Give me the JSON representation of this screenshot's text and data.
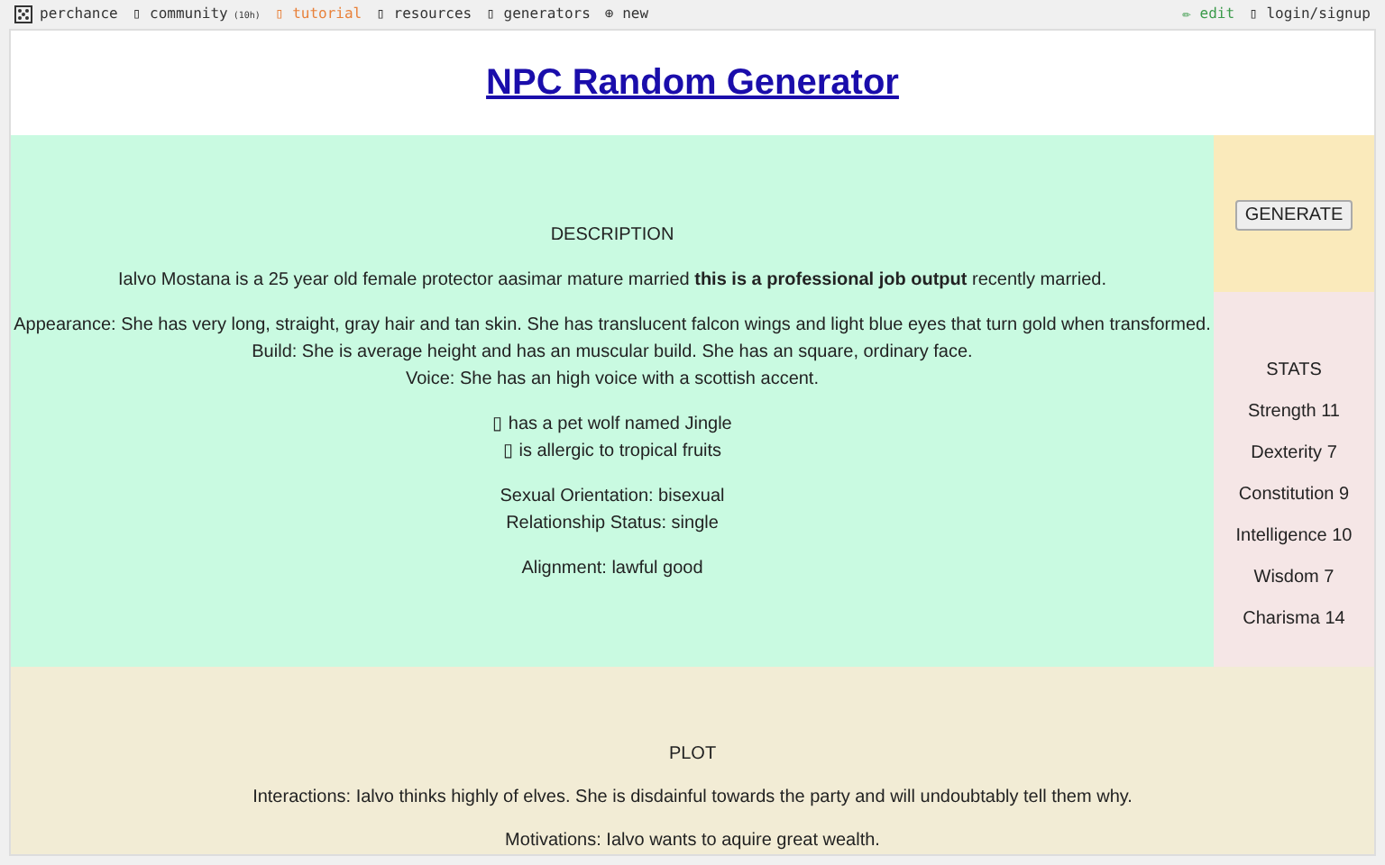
{
  "nav_left": [
    {
      "kind": "dice",
      "label": "perchance",
      "color": "#333333"
    },
    {
      "kind": "glyph",
      "icon": "▯",
      "label": "community",
      "badge": "(10h)",
      "color": "#333333"
    },
    {
      "kind": "glyph",
      "icon": "▯",
      "label": "tutorial",
      "color": "#e8813a"
    },
    {
      "kind": "glyph",
      "icon": "▯",
      "label": "resources",
      "color": "#333333"
    },
    {
      "kind": "glyph",
      "icon": "▯",
      "label": "generators",
      "color": "#333333"
    },
    {
      "kind": "glyph",
      "icon": "⊕",
      "label": "new",
      "color": "#333333"
    }
  ],
  "nav_right": [
    {
      "kind": "glyph",
      "icon": "✏",
      "label": "edit",
      "color": "#3a9a4a"
    },
    {
      "kind": "glyph",
      "icon": "▯",
      "label": "login/signup",
      "color": "#333333"
    }
  ],
  "title": "NPC Random Generator",
  "generate_button": "GENERATE",
  "description": {
    "heading": "DESCRIPTION",
    "paragraphs": [
      [
        "Ialvo Mostana is a 25 year old female protector aasimar mature married **this is a professional job output** recently married."
      ],
      [
        "Appearance: She has very long, straight, gray hair and tan skin. She has translucent falcon wings and light blue eyes that turn gold when transformed.",
        "Build: She is average height and has an muscular build. She has an square, ordinary face.",
        "Voice: She has an high voice with a scottish accent."
      ],
      [
        "▯ has a pet wolf named Jingle",
        "▯ is allergic to tropical fruits"
      ],
      [
        "Sexual Orientation: bisexual",
        "Relationship Status: single"
      ],
      [
        "Alignment: lawful good"
      ]
    ]
  },
  "stats": {
    "heading": "STATS",
    "items": [
      "Strength 11",
      "Dexterity 7",
      "Constitution 9",
      "Intelligence 10",
      "Wisdom 7",
      "Charisma 14"
    ]
  },
  "plot": {
    "heading": "PLOT",
    "paragraphs": [
      "Interactions: Ialvo thinks highly of elves. She is disdainful towards the party and will undoubtably tell them why.",
      "Motivations: Ialvo wants to aquire great wealth."
    ]
  }
}
